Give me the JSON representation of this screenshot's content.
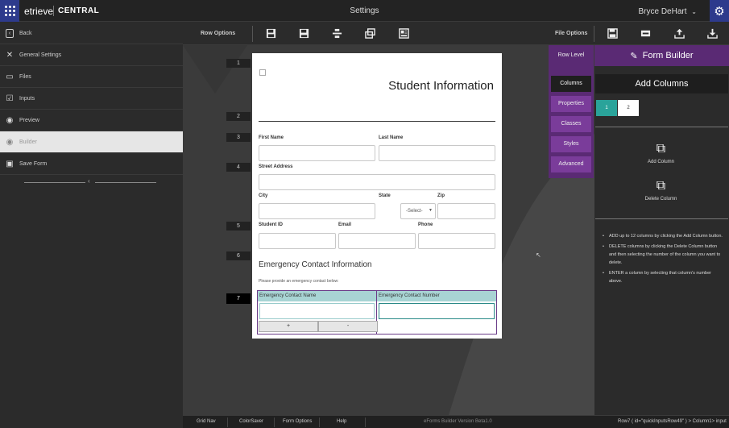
{
  "header": {
    "brand": "etrieve",
    "product": "CENTRAL",
    "page_title": "Settings",
    "user": "Bryce DeHart",
    "user_chevron": "⌄"
  },
  "sidebar": {
    "items": [
      {
        "label": "Back",
        "icon": "chevron-left-icon"
      },
      {
        "label": "General Settings",
        "icon": "tools-icon"
      },
      {
        "label": "Files",
        "icon": "inbox-icon"
      },
      {
        "label": "Inputs",
        "icon": "checkbox-icon"
      },
      {
        "label": "Preview",
        "icon": "eye-icon"
      },
      {
        "label": "Builder",
        "icon": "eye-icon"
      },
      {
        "label": "Save Form",
        "icon": "floppy-icon"
      }
    ],
    "active": "Builder"
  },
  "toolbar": {
    "row_options": "Row Options",
    "file_options": "File Options"
  },
  "canvas": {
    "row_numbers": [
      "1",
      "2",
      "3",
      "4",
      "5",
      "6",
      "7"
    ],
    "selected_row": "7"
  },
  "form": {
    "title": "Student Information",
    "labels": {
      "first_name": "First Name",
      "last_name": "Last Name",
      "street": "Street Address",
      "city": "City",
      "state": "State",
      "zip": "Zip",
      "student_id": "Student ID",
      "email": "Email",
      "phone": "Phone"
    },
    "state_value": "-Select-",
    "section_title": "Emergency Contact Information",
    "section_sub": "Please provide an emergency contact below:",
    "row7": {
      "col1_label": "Emergency Contact Name",
      "col2_label": "Emergency Contact Number",
      "add_btn": "+",
      "remove_btn": "-"
    }
  },
  "tabs": {
    "row_level": "Row Level",
    "items": [
      "Columns",
      "Properties",
      "Classes",
      "Styles",
      "Advanced"
    ],
    "active": "Columns"
  },
  "panel": {
    "title": "Form Builder",
    "add_columns_title": "Add Columns",
    "column_picks": [
      "1",
      "2"
    ],
    "add_column": "Add Column",
    "delete_column": "Delete Column",
    "help": [
      "ADD up to 12 columns by clicking the Add Column button.",
      "DELETE columns by clicking the Delete Column button and then selecting the number of the column you want to delete.",
      "ENTER a column by selecting that column's number above."
    ]
  },
  "status": {
    "grid_nav": "Grid Nav",
    "color_saver": "ColorSaver",
    "form_options": "Form Options",
    "help": "Help",
    "version": "eForms Builder Version Beta1.0",
    "selection": "Row7 ( id=\"quickInputsRow49\" ) > Column1> input"
  },
  "colors": {
    "accent_blue": "#2d3a8c",
    "purple": "#5a2a74",
    "teal": "#2aa39a"
  }
}
